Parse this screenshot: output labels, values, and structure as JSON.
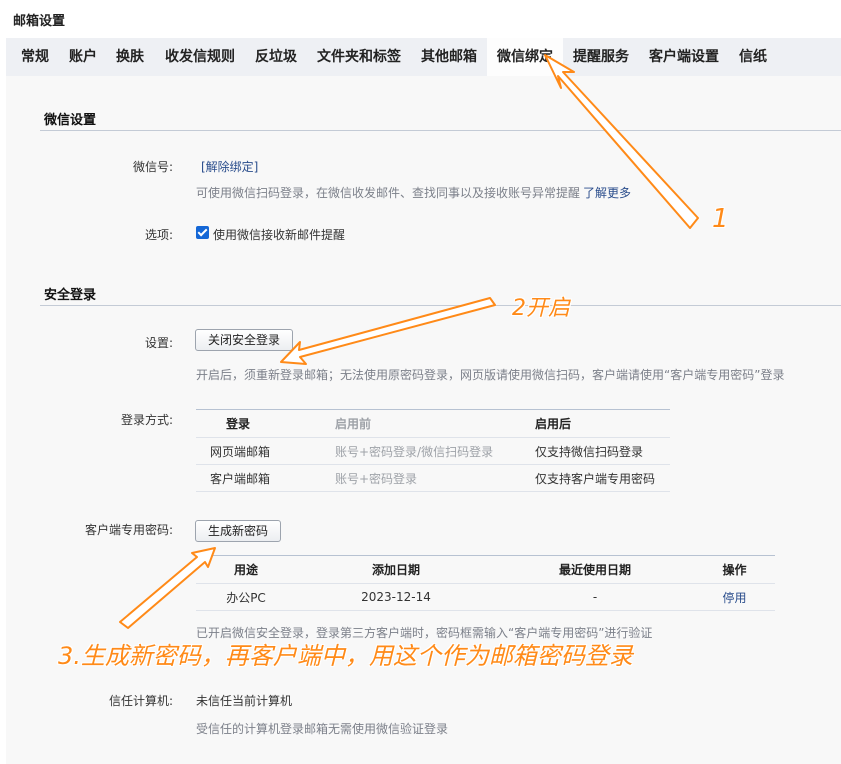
{
  "page_title": "邮箱设置",
  "tabs": [
    "常规",
    "账户",
    "换肤",
    "收发信规则",
    "反垃圾",
    "文件夹和标签",
    "其他邮箱",
    "微信绑定",
    "提醒服务",
    "客户端设置",
    "信纸"
  ],
  "wechat_settings": {
    "title": "微信设置",
    "wechat_id_label": "微信号:",
    "unbind_link": "[解除绑定]",
    "hint": "可使用微信扫码登录，在微信收发邮件、查找同事以及接收账号异常提醒",
    "learn_more": "了解更多",
    "option_label": "选项:",
    "option_text": "使用微信接收新邮件提醒",
    "option_checked": true
  },
  "secure_login": {
    "title": "安全登录",
    "setting_label": "设置:",
    "toggle_button": "关闭安全登录",
    "setting_hint": "开启后，须重新登录邮箱；无法使用原密码登录，网页版请使用微信扫码，客户端请使用“客户端专用密码”登录",
    "method_label": "登录方式:",
    "method_table": {
      "headers": [
        "登录",
        "启用前",
        "启用后"
      ],
      "rows": [
        [
          "网页端邮箱",
          "账号+密码登录/微信扫码登录",
          "仅支持微信扫码登录"
        ],
        [
          "客户端邮箱",
          "账号+密码登录",
          "仅支持客户端专用密码"
        ]
      ]
    },
    "client_pw_label": "客户端专用密码:",
    "generate_button": "生成新密码",
    "pw_table": {
      "headers": [
        "用途",
        "添加日期",
        "最近使用日期",
        "操作"
      ],
      "rows": [
        [
          "办公PC",
          "2023-12-14",
          "-",
          "停用"
        ]
      ]
    },
    "pw_hint": "已开启微信安全登录，登录第三方客户端时，密码框需输入“客户端专用密码”进行验证",
    "trust_label": "信任计算机:",
    "trust_value": "未信任当前计算机",
    "trust_hint": "受信任的计算机登录邮箱无需使用微信验证登录"
  },
  "annotations": {
    "step1": "1",
    "step2": "2开启",
    "step3": "3.生成新密码，再客户端中，用这个作为邮箱密码登录",
    "color": "#ff8a18"
  },
  "colors": {
    "tabbar_bg": "#eef0f4",
    "content_bg": "#f8f8f8",
    "checkbox": "#1467d6",
    "link": "#2a4d8c",
    "annotation": "#ff8a18"
  }
}
